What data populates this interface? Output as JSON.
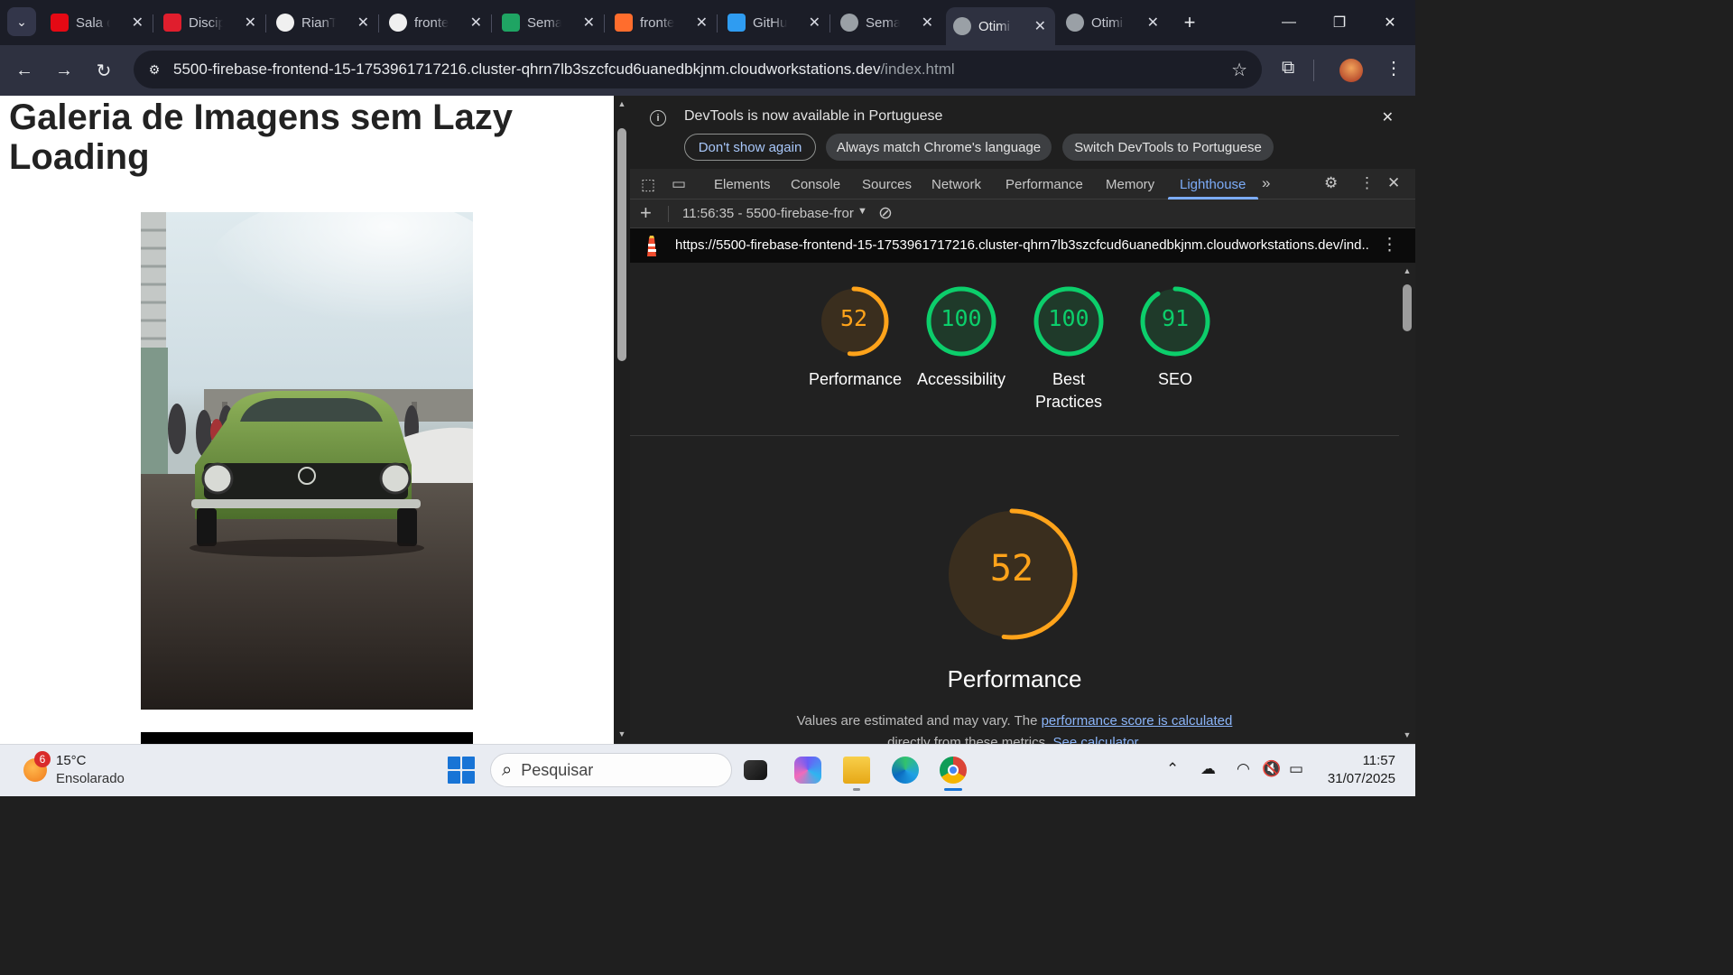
{
  "browser": {
    "tabs": [
      {
        "title": "Sala de",
        "favicon": "netflix-icon",
        "color": "#e50914"
      },
      {
        "title": "Discip",
        "favicon": "red-square-icon",
        "color": "#e01e2d"
      },
      {
        "title": "RianT",
        "favicon": "github-icon",
        "color": "#ffffff"
      },
      {
        "title": "fronte",
        "favicon": "github-icon",
        "color": "#ffffff"
      },
      {
        "title": "Sema",
        "favicon": "google-drive-icon",
        "color": "#1fa463"
      },
      {
        "title": "fronte",
        "favicon": "firebase-icon",
        "color": "#ff6d2d"
      },
      {
        "title": "GitHu",
        "favicon": "vscode-icon",
        "color": "#2f9cf1"
      },
      {
        "title": "Sema",
        "favicon": "globe-icon",
        "color": "#9aa0a6"
      },
      {
        "title": "Otimi",
        "favicon": "globe-icon",
        "color": "#9aa0a6",
        "active": true
      },
      {
        "title": "Otimi",
        "favicon": "globe-icon",
        "color": "#9aa0a6"
      }
    ],
    "url_host": "5500-firebase-frontend-15-1753961717216.cluster-qhrn7lb3szcfcud6uanedbkjnm.cloudworkstations.dev",
    "url_path": "/index.html"
  },
  "page": {
    "heading": "Galeria de Imagens sem Lazy Loading"
  },
  "devtools": {
    "infobar": {
      "message": "DevTools is now available in Portuguese",
      "dont_show": "Don't show again",
      "always_match": "Always match Chrome's language",
      "switch": "Switch DevTools to Portuguese"
    },
    "tabs": [
      "Elements",
      "Console",
      "Sources",
      "Network",
      "Performance",
      "Memory",
      "Lighthouse"
    ],
    "active_tab": "Lighthouse",
    "report_selector": "11:56:35 - 5500-firebase-fror",
    "report_url": "https://5500-firebase-frontend-15-1753961717216.cluster-qhrn7lb3szcfcud6uanedbkjnm.cloudworkstations.dev/ind...",
    "scores": [
      {
        "value": 52,
        "label": "Performance",
        "color": "#ffa31a"
      },
      {
        "value": 100,
        "label": "Accessibility",
        "color": "#0cce6b"
      },
      {
        "value": 100,
        "label": "Best Practices",
        "color": "#0cce6b"
      },
      {
        "value": 91,
        "label": "SEO",
        "color": "#0cce6b"
      }
    ],
    "main_score": {
      "value": 52,
      "label": "Performance",
      "color": "#ffa31a"
    },
    "note_prefix": "Values are estimated and may vary. The ",
    "note_link": "performance score is calculated",
    "note_line2": "directly from these metrics. ",
    "note_link2": "See calculator."
  },
  "taskbar": {
    "weather_temp": "15°C",
    "weather_desc": "Ensolarado",
    "weather_badge": "6",
    "search_placeholder": "Pesquisar",
    "time": "11:57",
    "date": "31/07/2025"
  }
}
